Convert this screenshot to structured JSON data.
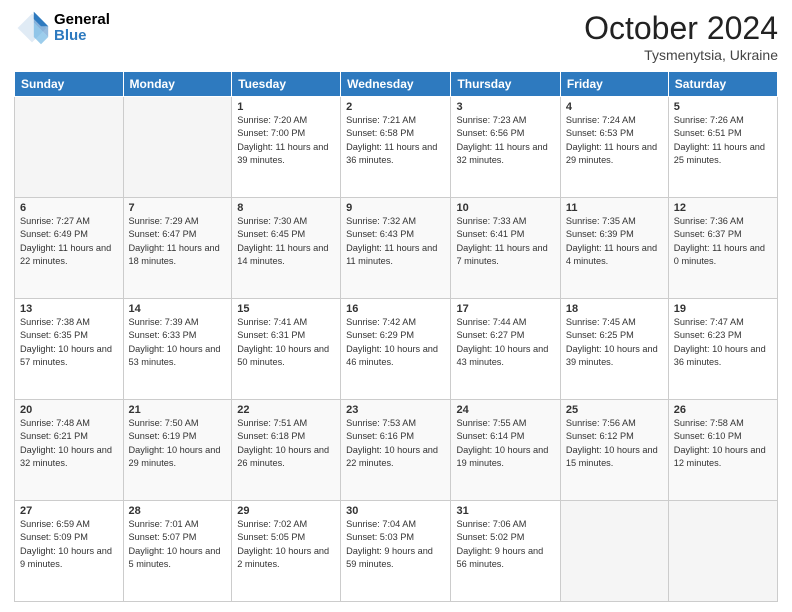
{
  "header": {
    "logo_general": "General",
    "logo_blue": "Blue",
    "month_title": "October 2024",
    "location": "Tysmenytsia, Ukraine"
  },
  "days_of_week": [
    "Sunday",
    "Monday",
    "Tuesday",
    "Wednesday",
    "Thursday",
    "Friday",
    "Saturday"
  ],
  "weeks": [
    [
      {
        "day": "",
        "empty": true
      },
      {
        "day": "",
        "empty": true
      },
      {
        "day": "1",
        "sunrise": "Sunrise: 7:20 AM",
        "sunset": "Sunset: 7:00 PM",
        "daylight": "Daylight: 11 hours and 39 minutes."
      },
      {
        "day": "2",
        "sunrise": "Sunrise: 7:21 AM",
        "sunset": "Sunset: 6:58 PM",
        "daylight": "Daylight: 11 hours and 36 minutes."
      },
      {
        "day": "3",
        "sunrise": "Sunrise: 7:23 AM",
        "sunset": "Sunset: 6:56 PM",
        "daylight": "Daylight: 11 hours and 32 minutes."
      },
      {
        "day": "4",
        "sunrise": "Sunrise: 7:24 AM",
        "sunset": "Sunset: 6:53 PM",
        "daylight": "Daylight: 11 hours and 29 minutes."
      },
      {
        "day": "5",
        "sunrise": "Sunrise: 7:26 AM",
        "sunset": "Sunset: 6:51 PM",
        "daylight": "Daylight: 11 hours and 25 minutes."
      }
    ],
    [
      {
        "day": "6",
        "sunrise": "Sunrise: 7:27 AM",
        "sunset": "Sunset: 6:49 PM",
        "daylight": "Daylight: 11 hours and 22 minutes."
      },
      {
        "day": "7",
        "sunrise": "Sunrise: 7:29 AM",
        "sunset": "Sunset: 6:47 PM",
        "daylight": "Daylight: 11 hours and 18 minutes."
      },
      {
        "day": "8",
        "sunrise": "Sunrise: 7:30 AM",
        "sunset": "Sunset: 6:45 PM",
        "daylight": "Daylight: 11 hours and 14 minutes."
      },
      {
        "day": "9",
        "sunrise": "Sunrise: 7:32 AM",
        "sunset": "Sunset: 6:43 PM",
        "daylight": "Daylight: 11 hours and 11 minutes."
      },
      {
        "day": "10",
        "sunrise": "Sunrise: 7:33 AM",
        "sunset": "Sunset: 6:41 PM",
        "daylight": "Daylight: 11 hours and 7 minutes."
      },
      {
        "day": "11",
        "sunrise": "Sunrise: 7:35 AM",
        "sunset": "Sunset: 6:39 PM",
        "daylight": "Daylight: 11 hours and 4 minutes."
      },
      {
        "day": "12",
        "sunrise": "Sunrise: 7:36 AM",
        "sunset": "Sunset: 6:37 PM",
        "daylight": "Daylight: 11 hours and 0 minutes."
      }
    ],
    [
      {
        "day": "13",
        "sunrise": "Sunrise: 7:38 AM",
        "sunset": "Sunset: 6:35 PM",
        "daylight": "Daylight: 10 hours and 57 minutes."
      },
      {
        "day": "14",
        "sunrise": "Sunrise: 7:39 AM",
        "sunset": "Sunset: 6:33 PM",
        "daylight": "Daylight: 10 hours and 53 minutes."
      },
      {
        "day": "15",
        "sunrise": "Sunrise: 7:41 AM",
        "sunset": "Sunset: 6:31 PM",
        "daylight": "Daylight: 10 hours and 50 minutes."
      },
      {
        "day": "16",
        "sunrise": "Sunrise: 7:42 AM",
        "sunset": "Sunset: 6:29 PM",
        "daylight": "Daylight: 10 hours and 46 minutes."
      },
      {
        "day": "17",
        "sunrise": "Sunrise: 7:44 AM",
        "sunset": "Sunset: 6:27 PM",
        "daylight": "Daylight: 10 hours and 43 minutes."
      },
      {
        "day": "18",
        "sunrise": "Sunrise: 7:45 AM",
        "sunset": "Sunset: 6:25 PM",
        "daylight": "Daylight: 10 hours and 39 minutes."
      },
      {
        "day": "19",
        "sunrise": "Sunrise: 7:47 AM",
        "sunset": "Sunset: 6:23 PM",
        "daylight": "Daylight: 10 hours and 36 minutes."
      }
    ],
    [
      {
        "day": "20",
        "sunrise": "Sunrise: 7:48 AM",
        "sunset": "Sunset: 6:21 PM",
        "daylight": "Daylight: 10 hours and 32 minutes."
      },
      {
        "day": "21",
        "sunrise": "Sunrise: 7:50 AM",
        "sunset": "Sunset: 6:19 PM",
        "daylight": "Daylight: 10 hours and 29 minutes."
      },
      {
        "day": "22",
        "sunrise": "Sunrise: 7:51 AM",
        "sunset": "Sunset: 6:18 PM",
        "daylight": "Daylight: 10 hours and 26 minutes."
      },
      {
        "day": "23",
        "sunrise": "Sunrise: 7:53 AM",
        "sunset": "Sunset: 6:16 PM",
        "daylight": "Daylight: 10 hours and 22 minutes."
      },
      {
        "day": "24",
        "sunrise": "Sunrise: 7:55 AM",
        "sunset": "Sunset: 6:14 PM",
        "daylight": "Daylight: 10 hours and 19 minutes."
      },
      {
        "day": "25",
        "sunrise": "Sunrise: 7:56 AM",
        "sunset": "Sunset: 6:12 PM",
        "daylight": "Daylight: 10 hours and 15 minutes."
      },
      {
        "day": "26",
        "sunrise": "Sunrise: 7:58 AM",
        "sunset": "Sunset: 6:10 PM",
        "daylight": "Daylight: 10 hours and 12 minutes."
      }
    ],
    [
      {
        "day": "27",
        "sunrise": "Sunrise: 6:59 AM",
        "sunset": "Sunset: 5:09 PM",
        "daylight": "Daylight: 10 hours and 9 minutes."
      },
      {
        "day": "28",
        "sunrise": "Sunrise: 7:01 AM",
        "sunset": "Sunset: 5:07 PM",
        "daylight": "Daylight: 10 hours and 5 minutes."
      },
      {
        "day": "29",
        "sunrise": "Sunrise: 7:02 AM",
        "sunset": "Sunset: 5:05 PM",
        "daylight": "Daylight: 10 hours and 2 minutes."
      },
      {
        "day": "30",
        "sunrise": "Sunrise: 7:04 AM",
        "sunset": "Sunset: 5:03 PM",
        "daylight": "Daylight: 9 hours and 59 minutes."
      },
      {
        "day": "31",
        "sunrise": "Sunrise: 7:06 AM",
        "sunset": "Sunset: 5:02 PM",
        "daylight": "Daylight: 9 hours and 56 minutes."
      },
      {
        "day": "",
        "empty": true
      },
      {
        "day": "",
        "empty": true
      }
    ]
  ]
}
